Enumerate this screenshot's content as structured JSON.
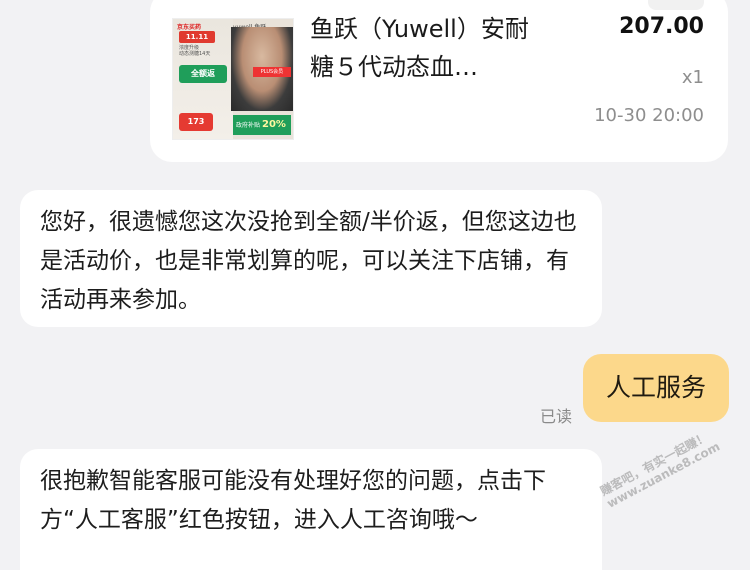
{
  "order": {
    "title": "鱼跃（Yuwell）安耐糖５代动态血…",
    "price": "207.00",
    "quantity": "x1",
    "time": "10-30 20:00",
    "thumbnail": {
      "brand": "京东买药",
      "brand2": "yuwell 鱼跃",
      "badge": "11.11",
      "line1": "浓度升级",
      "line2": "动态测糖14天",
      "green_label": "全额返",
      "price_tag": "173",
      "plus_label": "PLUS会员",
      "subsidy_label": "政府补贴",
      "subsidy_value": "20%"
    }
  },
  "messages": [
    {
      "role": "agent",
      "text": "您好，很遗憾您这次没抢到全额/半价返，但您这边也是活动价，也是非常划算的呢，可以关注下店铺，有活动再来参加。"
    },
    {
      "role": "user",
      "text": "人工服务",
      "status": "已读"
    },
    {
      "role": "agent",
      "text": "很抱歉智能客服可能没有处理好您的问题，点击下方“人工客服”红色按钮，进入人工咨询哦～"
    }
  ],
  "watermark": {
    "line1": "赚客吧，有实一起赚！",
    "line2": "www.zuanke8.com"
  },
  "colors": {
    "background": "#f2f2f4",
    "bubble_agent": "#ffffff",
    "bubble_user": "#fcd88b",
    "muted_text": "#8e8e8e"
  }
}
